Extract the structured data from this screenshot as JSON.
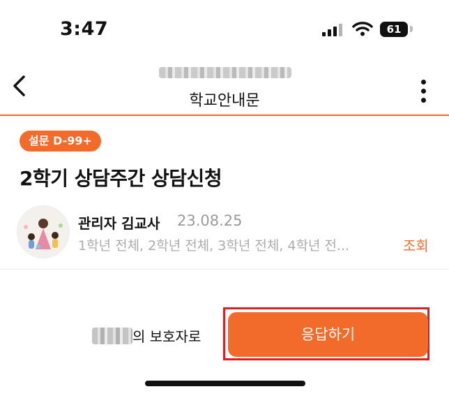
{
  "status_bar": {
    "time": "3:47",
    "battery": "61"
  },
  "header": {
    "title": "학교안내문",
    "back_icon": "chevron-left-icon",
    "more_icon": "vertical-dots-icon"
  },
  "post": {
    "badge": "설문 D-99+",
    "title": "2학기 상담주간 상담신청",
    "author": "관리자 김교사",
    "date": "23.08.25",
    "targets": "1학년 전체, 2학년 전체, 3학년 전체, 4학년 전...",
    "view_label": "조회"
  },
  "footer": {
    "guardian_suffix": "의 보호자로",
    "respond_label": "응답하기"
  },
  "colors": {
    "accent": "#f36b2a",
    "highlight": "#e01d1d"
  }
}
